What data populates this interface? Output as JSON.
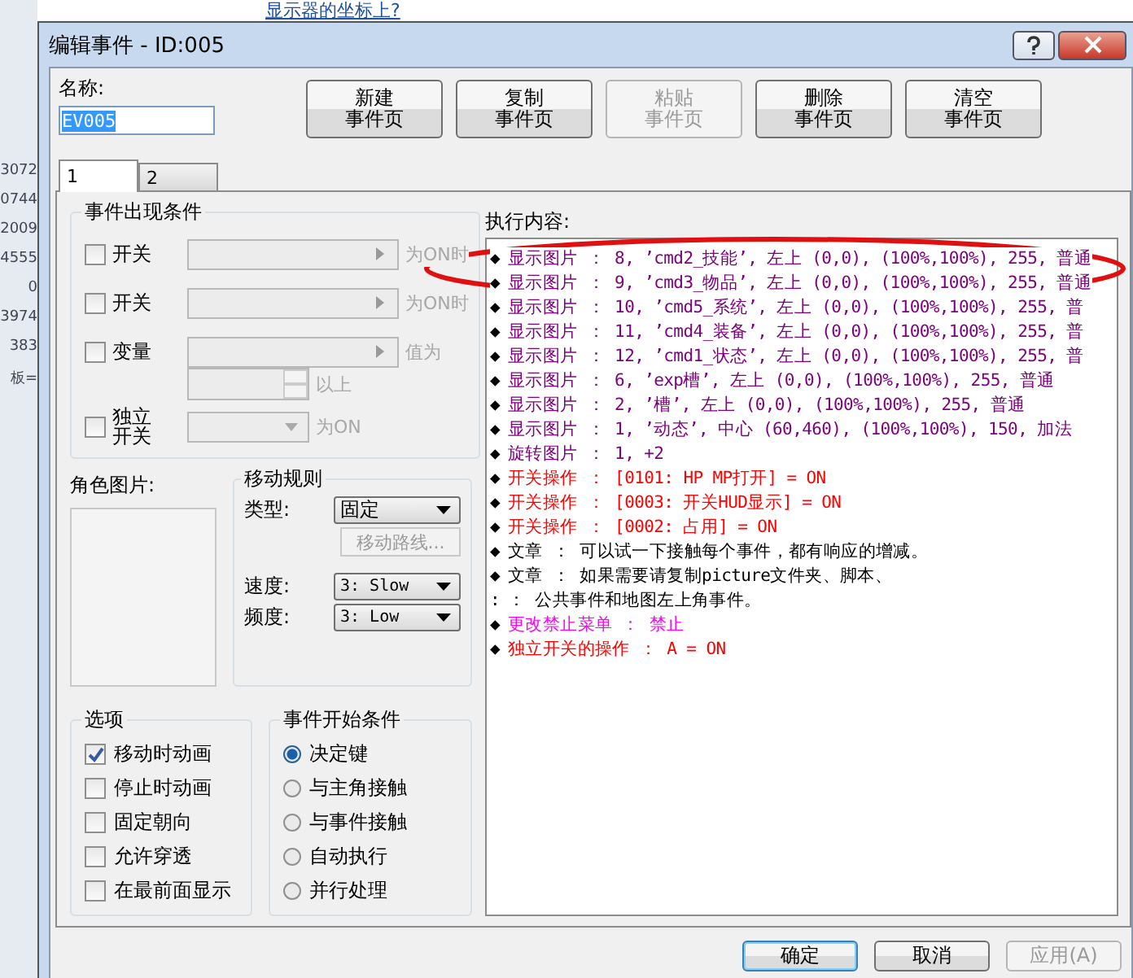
{
  "background_page": {
    "heading": "显示器的坐标上?",
    "side_texts": [
      "3072",
      "0744",
      "2009",
      "4555",
      "0",
      "3974",
      "383",
      "板="
    ]
  },
  "window": {
    "title": "编辑事件 - ID:005"
  },
  "name_field": {
    "label": "名称:",
    "value": "EV005"
  },
  "page_buttons": [
    {
      "lines": [
        "新建",
        "事件页"
      ],
      "disabled": false
    },
    {
      "lines": [
        "复制",
        "事件页"
      ],
      "disabled": false
    },
    {
      "lines": [
        "粘贴",
        "事件页"
      ],
      "disabled": true
    },
    {
      "lines": [
        "删除",
        "事件页"
      ],
      "disabled": false
    },
    {
      "lines": [
        "清空",
        "事件页"
      ],
      "disabled": false
    }
  ],
  "tabs": [
    {
      "label": "1",
      "selected": true
    },
    {
      "label": "2",
      "selected": false
    }
  ],
  "conditions": {
    "title": "事件出现条件",
    "rows": [
      {
        "kind": "select",
        "label": "开关",
        "checked": false,
        "suffix": "为ON时"
      },
      {
        "kind": "select",
        "label": "开关",
        "checked": false,
        "suffix": "为ON时"
      },
      {
        "kind": "select",
        "label": "变量",
        "checked": false,
        "suffix": "值为"
      },
      {
        "kind": "spin",
        "suffix": "以上"
      },
      {
        "kind": "dropdown",
        "label": "独立开关",
        "checked": false,
        "suffix": "为ON"
      }
    ]
  },
  "character_image": {
    "label": "角色图片:"
  },
  "movement": {
    "title": "移动规则",
    "type_label": "类型:",
    "type_value": "固定",
    "route_button": {
      "label": "移动路线...",
      "disabled": true
    },
    "speed_label": "速度:",
    "speed_value": "3: Slow",
    "freq_label": "频度:",
    "freq_value": "3: Low"
  },
  "options": {
    "title": "选项",
    "items": [
      {
        "label": "移动时动画",
        "checked": true
      },
      {
        "label": "停止时动画",
        "checked": false
      },
      {
        "label": "固定朝向",
        "checked": false
      },
      {
        "label": "允许穿透",
        "checked": false
      },
      {
        "label": "在最前面显示",
        "checked": false
      }
    ]
  },
  "trigger": {
    "title": "事件开始条件",
    "items": [
      {
        "label": "决定键",
        "selected": true
      },
      {
        "label": "与主角接触",
        "selected": false
      },
      {
        "label": "与事件接触",
        "selected": false
      },
      {
        "label": "自动执行",
        "selected": false
      },
      {
        "label": "并行处理",
        "selected": false
      }
    ]
  },
  "commands": {
    "title": "执行内容:",
    "lines": [
      {
        "kind": "picture",
        "marker": "◆",
        "text": "显示图片 ： 8, ’cmd2_技能’, 左上 (0,0), (100%,100%), 255, 普通"
      },
      {
        "kind": "picture",
        "marker": "◆",
        "text": "显示图片 ： 9, ’cmd3_物品’, 左上 (0,0), (100%,100%), 255, 普通"
      },
      {
        "kind": "picture",
        "marker": "◆",
        "text": "显示图片 ： 10, ’cmd5_系统’, 左上 (0,0), (100%,100%), 255, 普"
      },
      {
        "kind": "picture",
        "marker": "◆",
        "text": "显示图片 ： 11, ’cmd4_装备’, 左上 (0,0), (100%,100%), 255, 普"
      },
      {
        "kind": "picture",
        "marker": "◆",
        "text": "显示图片 ： 12, ’cmd1_状态’, 左上 (0,0), (100%,100%), 255, 普"
      },
      {
        "kind": "picture",
        "marker": "◆",
        "text": "显示图片 ： 6, ’exp槽’, 左上 (0,0), (100%,100%), 255, 普通"
      },
      {
        "kind": "picture",
        "marker": "◆",
        "text": "显示图片 ： 2, ’槽’, 左上 (0,0), (100%,100%), 255, 普通"
      },
      {
        "kind": "picture",
        "marker": "◆",
        "text": "显示图片 ： 1, ’动态’, 中心 (60,460), (100%,100%), 150, 加法"
      },
      {
        "kind": "picture",
        "marker": "◆",
        "text": "旋转图片 ： 1, +2"
      },
      {
        "kind": "switch",
        "marker": "◆",
        "text": "开关操作 ： [0101: HP MP打开] = ON"
      },
      {
        "kind": "switch",
        "marker": "◆",
        "text": "开关操作 ： [0003: 开关HUD显示] = ON"
      },
      {
        "kind": "switch",
        "marker": "◆",
        "text": "开关操作 ： [0002: 占用] = ON"
      },
      {
        "kind": "message",
        "marker": "◆",
        "text": "文章 ： 可以试一下接触每个事件，都有响应的增减。"
      },
      {
        "kind": "message",
        "marker": "◆",
        "text": "文章 ： 如果需要请复制picture文件夹、脚本、"
      },
      {
        "kind": "message",
        "marker": ":",
        "text": "     ： 公共事件和地图左上角事件。"
      },
      {
        "kind": "menu",
        "marker": "◆",
        "text": "更改禁止菜单 ： 禁止"
      },
      {
        "kind": "switch",
        "marker": "◆",
        "text": "独立开关的操作 ： A = ON"
      }
    ]
  },
  "dialog_buttons": [
    {
      "label": "确定",
      "default": true,
      "disabled": false
    },
    {
      "label": "取消",
      "default": false,
      "disabled": false
    },
    {
      "label": "应用(A)",
      "default": false,
      "disabled": true
    }
  ]
}
